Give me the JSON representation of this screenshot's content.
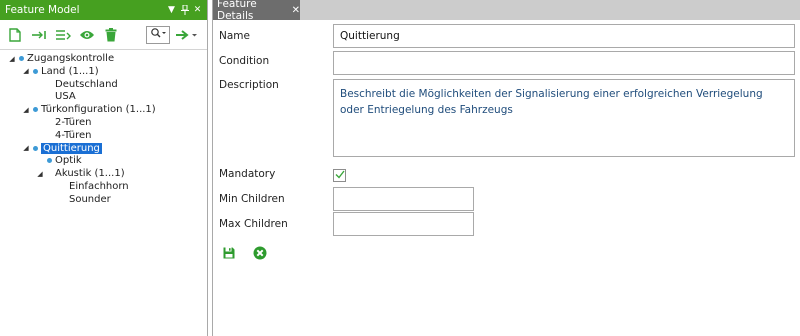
{
  "feature_model": {
    "title": "Feature Model",
    "header_buttons": [
      "dropdown-icon",
      "pin-icon",
      "close-icon"
    ],
    "toolbar_icons": [
      "new-file-icon",
      "indent-icon",
      "outdent-list-icon",
      "eye-icon",
      "trash-icon",
      "search-icon",
      "navigate-arrow-icon"
    ],
    "tree": [
      {
        "label": "Zugangskontrolle",
        "level": 0,
        "expander": "expanded",
        "dot": true
      },
      {
        "label": "Land (1...1)",
        "level": 1,
        "expander": "expanded",
        "dot": true
      },
      {
        "label": "Deutschland",
        "level": 2,
        "expander": "none",
        "dot": false
      },
      {
        "label": "USA",
        "level": 2,
        "expander": "none",
        "dot": false
      },
      {
        "label": "Türkonfiguration (1...1)",
        "level": 1,
        "expander": "expanded",
        "dot": true
      },
      {
        "label": "2-Türen",
        "level": 2,
        "expander": "none",
        "dot": false
      },
      {
        "label": "4-Türen",
        "level": 2,
        "expander": "none",
        "dot": false
      },
      {
        "label": "Quittierung",
        "level": 1,
        "expander": "expanded",
        "dot": true,
        "selected": true
      },
      {
        "label": "Optik",
        "level": 2,
        "expander": "none",
        "dot": true
      },
      {
        "label": "Akustik (1...1)",
        "level": 2,
        "expander": "expanded",
        "dot": false
      },
      {
        "label": "Einfachhorn",
        "level": 3,
        "expander": "none",
        "dot": false
      },
      {
        "label": "Sounder",
        "level": 3,
        "expander": "none",
        "dot": false
      }
    ]
  },
  "feature_details": {
    "tab_label": "Feature Details",
    "labels": {
      "name": "Name",
      "condition": "Condition",
      "description": "Description",
      "mandatory": "Mandatory",
      "min_children": "Min Children",
      "max_children": "Max Children"
    },
    "values": {
      "name": "Quittierung",
      "condition": "",
      "description": "Beschreibt die Möglichkeiten der Signalisierung einer erfolgreichen Verriegelung oder Entriegelung des Fahrzeugs",
      "mandatory": true,
      "min_children": "",
      "max_children": ""
    },
    "actions": [
      "save-icon",
      "cancel-icon"
    ]
  },
  "colors": {
    "header_green": "#46a020",
    "tab_gray": "#6d6d6d",
    "selection_blue": "#1a6fd4",
    "dot_blue": "#3d9ad6",
    "icon_green": "#3aa63a"
  }
}
